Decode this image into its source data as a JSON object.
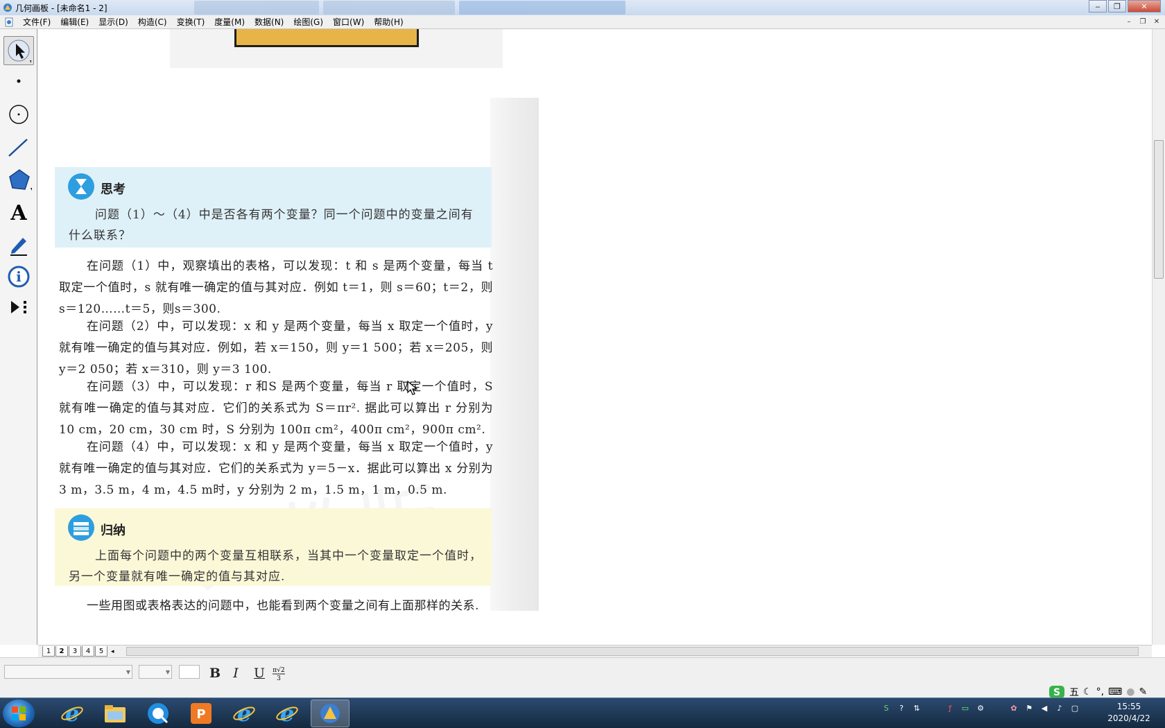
{
  "window": {
    "title": "几何画板 - [未命名1 - 2]",
    "icon": "geometer-sketchpad-icon"
  },
  "menubar": {
    "items": [
      "文件(F)",
      "编辑(E)",
      "显示(D)",
      "构造(C)",
      "变换(T)",
      "度量(M)",
      "数据(N)",
      "绘图(G)",
      "窗口(W)",
      "帮助(H)"
    ]
  },
  "toolbox": {
    "tools": [
      "arrow-select-tool",
      "point-tool",
      "compass-tool",
      "straightedge-tool",
      "polygon-tool",
      "text-tool",
      "marker-tool",
      "information-tool",
      "custom-tool"
    ],
    "selected": "arrow-select-tool",
    "text_tool_glyph": "A"
  },
  "document": {
    "think_box": {
      "title": "思考",
      "text": "问题（1）～（4）中是否各有两个变量？同一个问题中的变量之间有什么联系？"
    },
    "paragraphs": [
      "在问题（1）中，观察填出的表格，可以发现：t 和 s 是两个变量，每当 t 取定一个值时，s 就有唯一确定的值与其对应．例如 t＝1，则 s＝60；t＝2，则 s＝120……t＝5，则s＝300.",
      "在问题（2）中，可以发现：x 和 y 是两个变量，每当 x 取定一个值时，y 就有唯一确定的值与其对应．例如，若 x＝150，则 y＝1 500；若 x＝205，则y＝2 050；若 x＝310，则 y＝3 100.",
      "在问题（3）中，可以发现：r 和S 是两个变量，每当 r 取定一个值时，S 就有唯一确定的值与其对应．它们的关系式为 S＝πr². 据此可以算出 r 分别为 10 cm，20 cm，30 cm 时，S 分别为 100π cm²，400π cm²，900π cm².",
      "在问题（4）中，可以发现：x 和 y 是两个变量，每当 x 取定一个值时，y 就有唯一确定的值与其对应．它们的关系式为 y＝5－x．据此可以算出 x 分别为 3 m，3.5 m，4 m，4.5 m时，y 分别为 2 m，1.5 m，1 m，0.5 m."
    ],
    "summary_box": {
      "title": "归纳",
      "text": "上面每个问题中的两个变量互相联系，当其中一个变量取定一个值时，另一个变量就有唯一确定的值与其对应."
    },
    "closing": "一些用图或表格表达的问题中，也能看到两个变量之间有上面那样的关系."
  },
  "page_tabs": [
    "1",
    "2",
    "3",
    "4",
    "5"
  ],
  "active_page": "2",
  "text_format_bar": {
    "font_value": "",
    "size_value": "",
    "bold": "B",
    "italic": "I",
    "underline": "U"
  },
  "ime_bar": {
    "mode": "五"
  },
  "taskbar": {
    "apps": [
      "internet-explorer",
      "file-explorer",
      "qq-browser",
      "wps-presentation",
      "internet-explorer",
      "internet-explorer",
      "geometer-sketchpad"
    ],
    "active_app": "geometer-sketchpad"
  },
  "clock": {
    "time": "15:55",
    "date": "2020/4/22"
  },
  "colors": {
    "think_bg": "#dff1f8",
    "summary_bg": "#fbf8d8",
    "badge_blue": "#2d9ee0",
    "taskbar": "#1c3655"
  }
}
